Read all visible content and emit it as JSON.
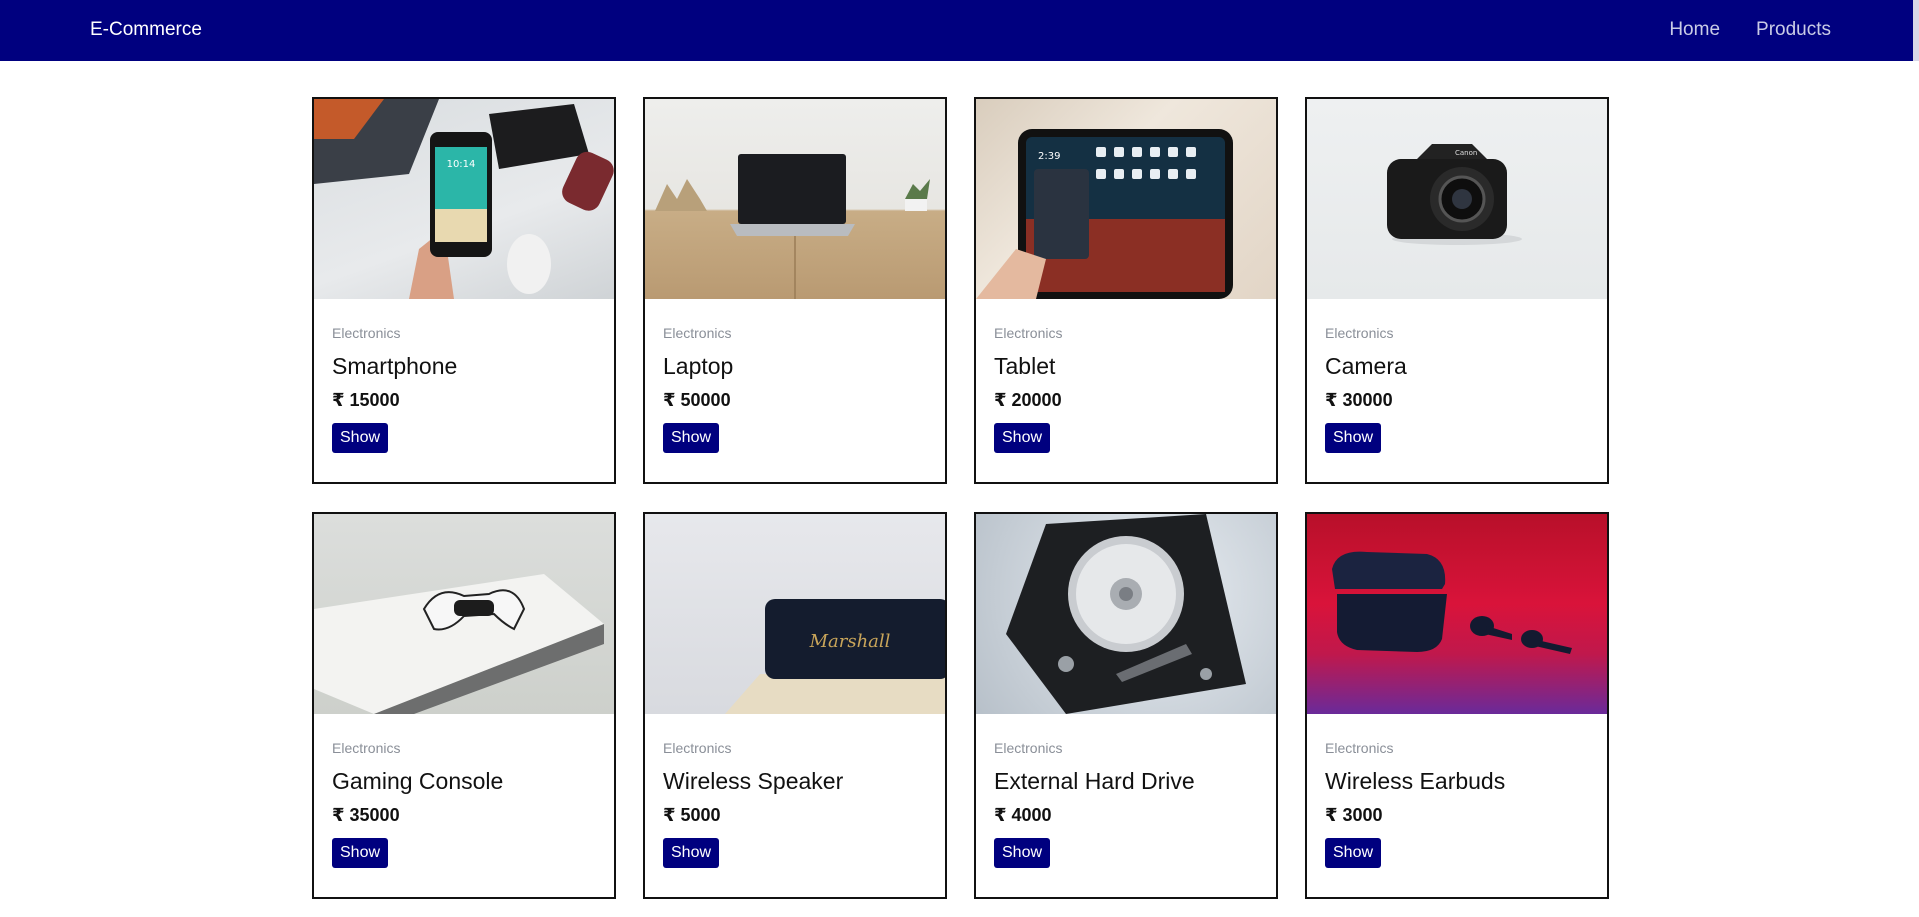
{
  "navbar": {
    "brand": "E-Commerce",
    "links": [
      {
        "label": "Home"
      },
      {
        "label": "Products"
      }
    ],
    "background": "#00007f"
  },
  "products": [
    {
      "category": "Electronics",
      "name": "Smartphone",
      "price": "₹ 15000",
      "button": "Show",
      "image": "smartphone-photo"
    },
    {
      "category": "Electronics",
      "name": "Laptop",
      "price": "₹ 50000",
      "button": "Show",
      "image": "laptop-photo"
    },
    {
      "category": "Electronics",
      "name": "Tablet",
      "price": "₹ 20000",
      "button": "Show",
      "image": "tablet-photo"
    },
    {
      "category": "Electronics",
      "name": "Camera",
      "price": "₹ 30000",
      "button": "Show",
      "image": "camera-photo"
    },
    {
      "category": "Electronics",
      "name": "Gaming Console",
      "price": "₹ 35000",
      "button": "Show",
      "image": "gaming-console-photo"
    },
    {
      "category": "Electronics",
      "name": "Wireless Speaker",
      "price": "₹ 5000",
      "button": "Show",
      "image": "wireless-speaker-photo",
      "image_text": "Marshall"
    },
    {
      "category": "Electronics",
      "name": "External Hard Drive",
      "price": "₹ 4000",
      "button": "Show",
      "image": "hard-drive-photo"
    },
    {
      "category": "Electronics",
      "name": "Wireless Earbuds",
      "price": "₹ 3000",
      "button": "Show",
      "image": "earbuds-photo"
    }
  ],
  "colors": {
    "accent": "#00007f",
    "category_text": "#8a8f98"
  }
}
